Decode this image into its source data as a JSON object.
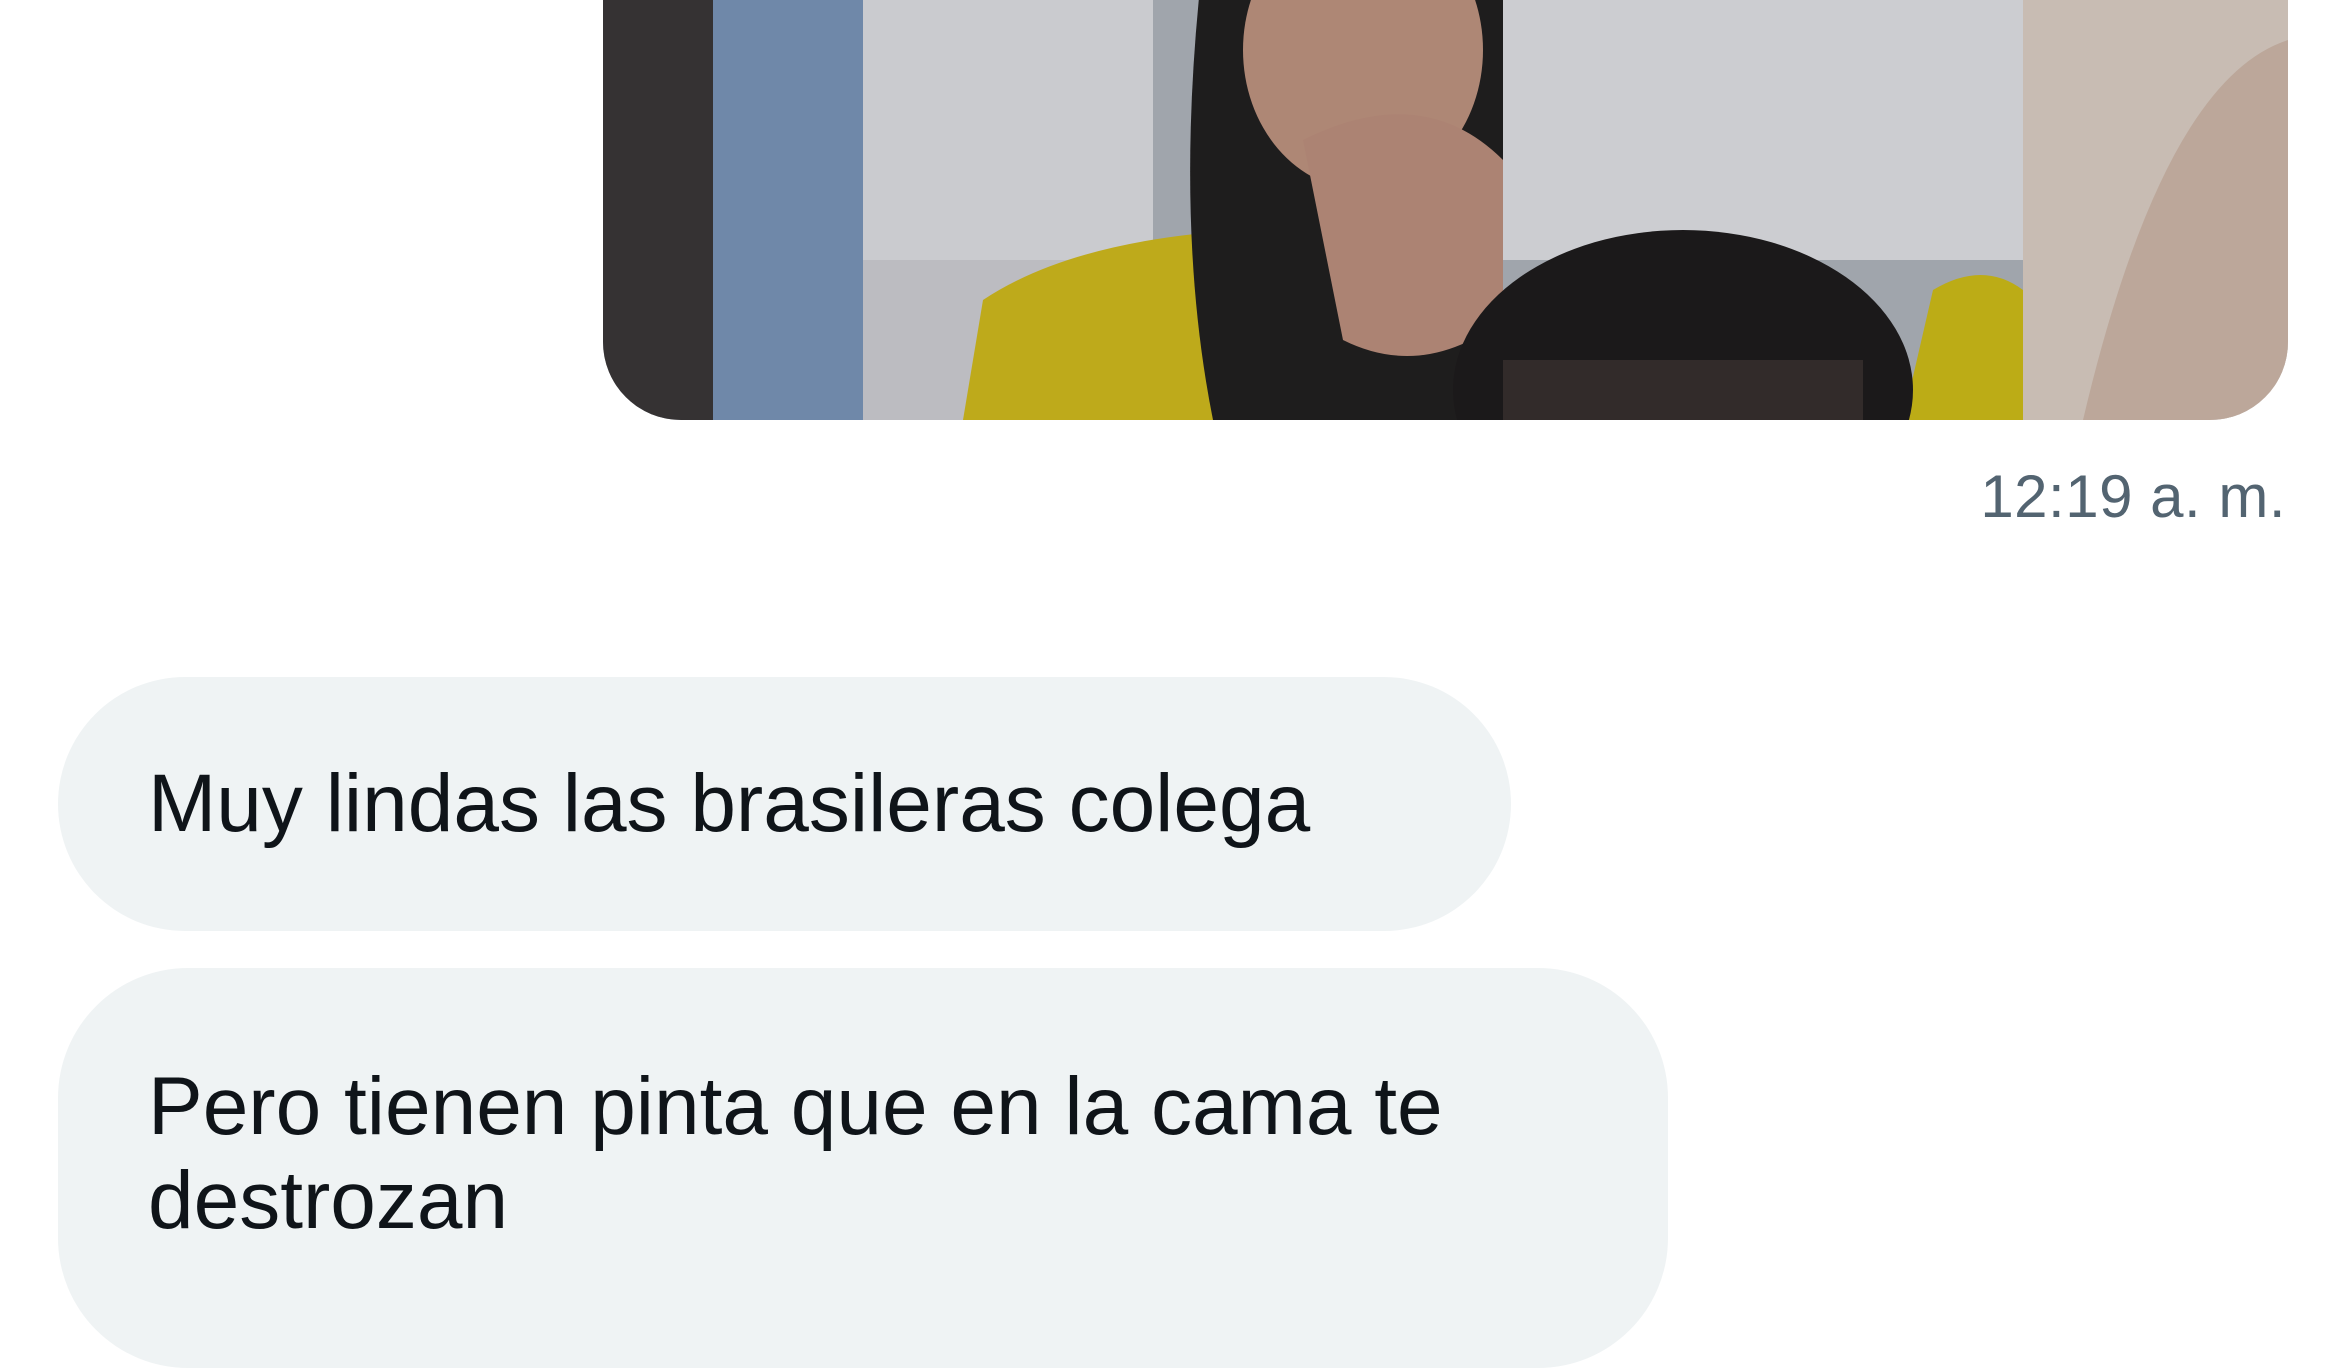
{
  "conversation": {
    "sent_media": {
      "alt": "photo",
      "timestamp": "12:19 a. m."
    },
    "received_messages": [
      {
        "text": "Muy lindas las brasileras colega"
      },
      {
        "text": "Pero tienen pinta que en la cama te destrozan"
      }
    ]
  },
  "colors": {
    "background": "#ffffff",
    "bubble_received": "#eff3f4",
    "text_primary": "#0f1419",
    "text_secondary": "#536471"
  }
}
